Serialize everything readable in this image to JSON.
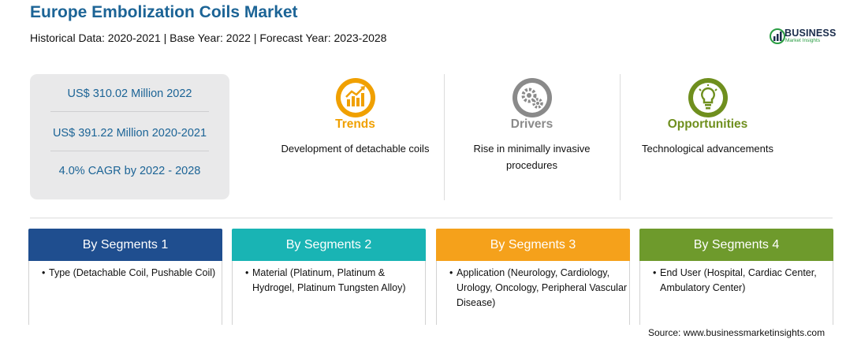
{
  "header": {
    "title": "Europe Embolization Coils Market",
    "subtitle": "Historical Data: 2020-2021 | Base Year: 2022 | Forecast Year: 2023-2028"
  },
  "logo": {
    "name": "BUSINESS",
    "tagline": "Market Insights"
  },
  "stats": [
    "US$ 310.02 Million 2022",
    "US$ 391.22 Million 2020-2021",
    "4.0% CAGR by 2022 - 2028"
  ],
  "highlights": [
    {
      "icon": "chart-growth-icon",
      "title": "Trends",
      "color": "#f0a000",
      "description": "Development of detachable coils"
    },
    {
      "icon": "gears-icon",
      "title": "Drivers",
      "color": "#8a8a8a",
      "description": "Rise in minimally invasive procedures"
    },
    {
      "icon": "lightbulb-icon",
      "title": "Opportunities",
      "color": "#6f8f1e",
      "description": "Technological advancements"
    }
  ],
  "segments": [
    {
      "title": "By Segments 1",
      "color": "#1f4e8f",
      "text": "Type (Detachable Coil, Pushable Coil)"
    },
    {
      "title": "By Segments 2",
      "color": "#19b4b4",
      "text": "Material (Platinum, Platinum & Hydrogel, Platinum Tungsten Alloy)"
    },
    {
      "title": "By Segments 3",
      "color": "#f5a11b",
      "text": "Application (Neurology, Cardiology, Urology, Oncology, Peripheral Vascular Disease)"
    },
    {
      "title": "By Segments 4",
      "color": "#6e9a2c",
      "text": "End User (Hospital, Cardiac Center, Ambulatory Center)"
    }
  ],
  "footer": {
    "source": "Source: www.businessmarketinsights.com"
  }
}
